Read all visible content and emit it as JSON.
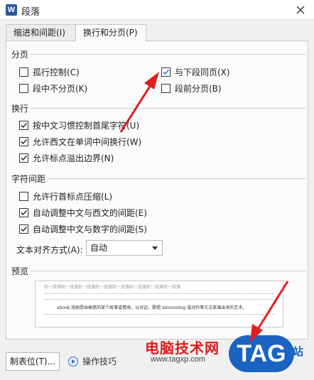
{
  "window": {
    "title": "段落",
    "app_icon_letter": "W"
  },
  "tabs": [
    {
      "label": "缩进和间距(I)",
      "active": false
    },
    {
      "label": "换行和分页(P)",
      "active": true
    }
  ],
  "sections": {
    "pagination": {
      "title": "分页",
      "widow_control": {
        "label": "孤行控制(C)",
        "checked": false
      },
      "keep_with_next": {
        "label": "与下段同页(X)",
        "checked": true
      },
      "keep_lines_together": {
        "label": "段中不分页(K)",
        "checked": false
      },
      "page_break_before": {
        "label": "段前分页(B)",
        "checked": false
      }
    },
    "line_break": {
      "title": "换行",
      "chinese_rules": {
        "label": "按中文习惯控制首尾字符(U)",
        "checked": true
      },
      "western_break": {
        "label": "允许西文在单词中间换行(W)",
        "checked": true
      },
      "punct_overflow": {
        "label": "允许标点溢出边界(N)",
        "checked": true
      }
    },
    "char_spacing": {
      "title": "字符间距",
      "compress_punct": {
        "label": "允许行首标点压缩(L)",
        "checked": false
      },
      "auto_cn_en": {
        "label": "自动调整中文与西文的间距(E)",
        "checked": true
      },
      "auto_cn_num": {
        "label": "自动调整中文与数字的间距(S)",
        "checked": true
      },
      "text_align": {
        "label": "文本对齐方式(A):",
        "value": "自动"
      }
    },
    "preview": {
      "title": "预览",
      "sample_line": "前一段落前一段落前一段落前一段落前一段落前一段落前一段落前一段落",
      "sample_text": "abook 戏剧是由搞笑的某个故事或情境，以对话、歌唱 interesting 或动作等方式表演出来的艺术。"
    }
  },
  "bottom": {
    "tab_stops_button": "制表位(T)...",
    "tips_link": "操作技巧"
  },
  "watermark": {
    "site_name": "电脑技术网",
    "url": "www.tagxp.com",
    "tag": "TAG",
    "side": "站"
  },
  "colors": {
    "accent_red": "#d81e1e",
    "brand_blue": "#1a63c2",
    "check_blue": "#2f6fdc"
  }
}
